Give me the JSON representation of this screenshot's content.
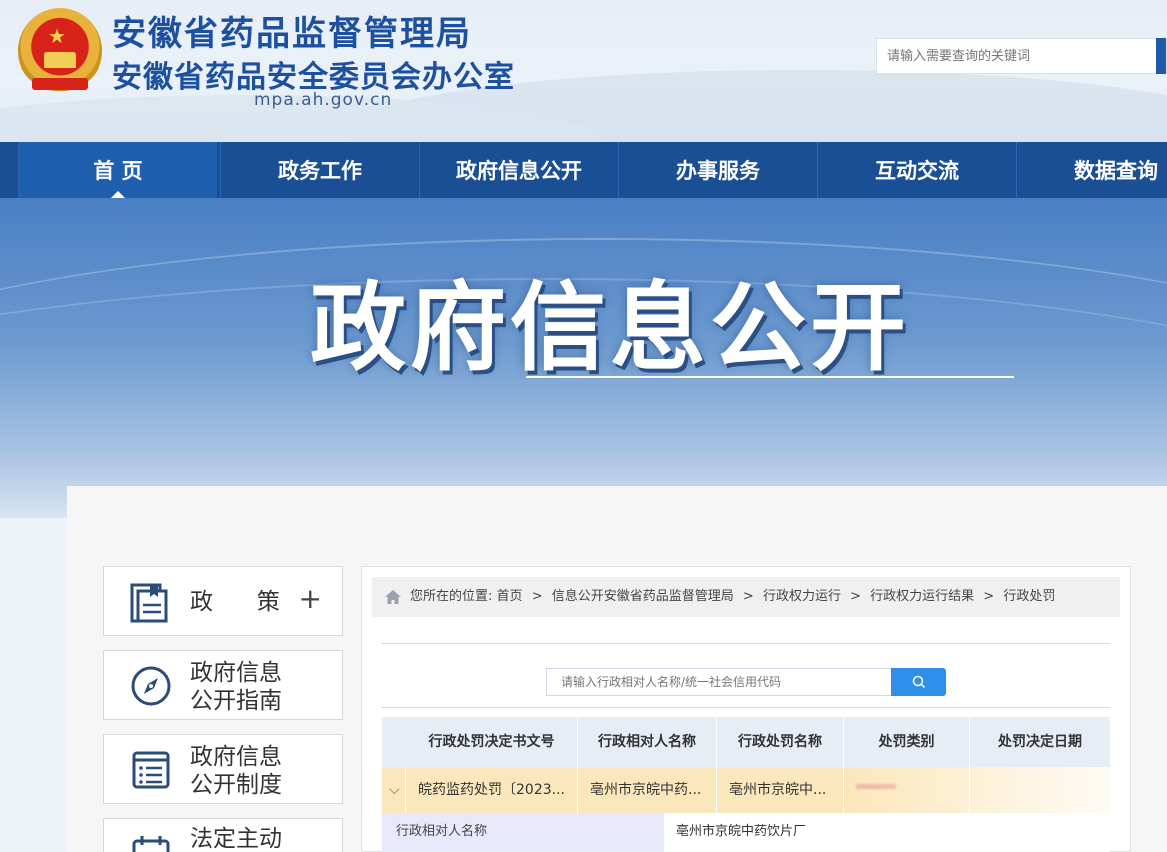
{
  "header": {
    "title_main": "安徽省药品监督管理局",
    "title_sub": "安徽省药品安全委员会办公室",
    "domain": "mpa.ah.gov.cn",
    "search_placeholder": "请输入需要查询的关键词"
  },
  "nav": {
    "items": [
      {
        "label": "首 页",
        "active": true
      },
      {
        "label": "政务工作"
      },
      {
        "label": "政府信息公开"
      },
      {
        "label": "办事服务"
      },
      {
        "label": "互动交流"
      },
      {
        "label": "数据查询"
      }
    ]
  },
  "banner": {
    "title": "政府信息公开"
  },
  "sidebar": {
    "items": [
      {
        "label": "政      策",
        "icon": "policy-book-icon",
        "expand": "+"
      },
      {
        "label_line1": "政府信息",
        "label_line2": "公开指南",
        "icon": "compass-icon"
      },
      {
        "label_line1": "政府信息",
        "label_line2": "公开制度",
        "icon": "list-document-icon"
      },
      {
        "label_line1": "法定主动",
        "icon": "calendar-icon"
      }
    ]
  },
  "breadcrumb": {
    "prefix": "您所在的位置:",
    "items": [
      "首页",
      "信息公开安徽省药品监督管理局",
      "行政权力运行",
      "行政权力运行结果",
      "行政处罚"
    ],
    "separator": ">"
  },
  "query": {
    "placeholder": "请输入行政相对人名称/统一社会信用代码"
  },
  "table": {
    "headers": [
      "行政处罚决定书文号",
      "行政相对人名称",
      "行政处罚名称",
      "处罚类别",
      "处罚决定日期"
    ],
    "rows": [
      {
        "toggle": "⌵",
        "doc_no": "皖药监药处罚〔2023...",
        "party": "亳州市京皖中药...",
        "penalty_name": "亳州市京皖中...",
        "category": "",
        "date": ""
      }
    ],
    "detail": {
      "key": "行政相对人名称",
      "value": "亳州市京皖中药饮片厂"
    }
  },
  "colors": {
    "nav": "#1a4f95",
    "title": "#1e50a0",
    "query_button": "#2e8fe8",
    "row_highlight": "#fbe7bc"
  }
}
